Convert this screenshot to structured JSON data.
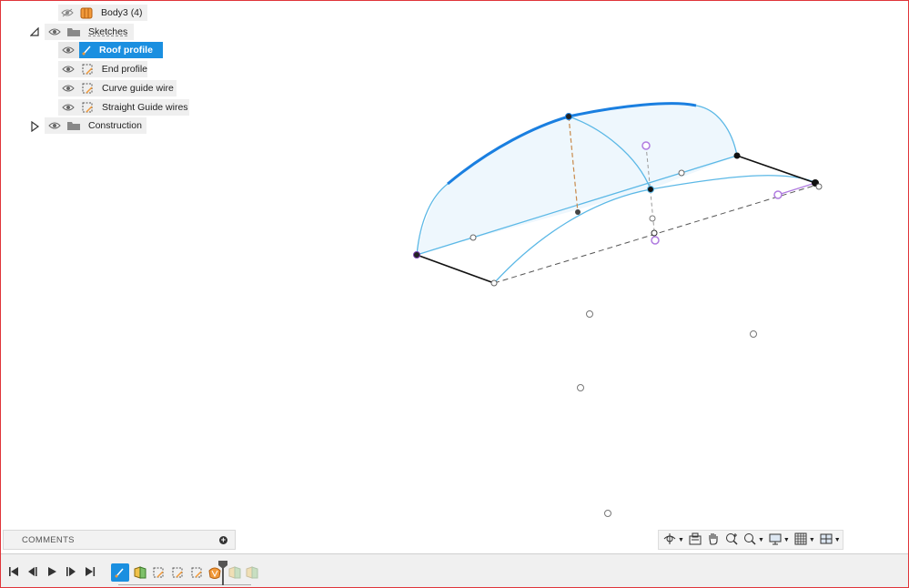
{
  "browser": {
    "items": [
      {
        "label": "Body3 (4)"
      },
      {
        "label": "Sketches"
      },
      {
        "label": "Roof profile"
      },
      {
        "label": "End profile"
      },
      {
        "label": "Curve guide wire"
      },
      {
        "label": "Straight Guide wires"
      },
      {
        "label": "Construction"
      }
    ]
  },
  "comments": {
    "label": "COMMENTS"
  },
  "navbar": {
    "icons": [
      "orbit-icon",
      "look-at-icon",
      "pan-icon",
      "zoom-window-icon",
      "zoom-icon",
      "display-settings-icon",
      "grid-icon",
      "viewports-icon"
    ]
  },
  "timeline": {
    "controls": [
      "skip-to-start",
      "step-back",
      "play",
      "step-forward",
      "skip-to-end"
    ]
  },
  "colors": {
    "accent": "#1a8fe0",
    "curve": "#5bb8e6",
    "fill": "#e9f5fc",
    "selected_curve": "#1a7fe0",
    "construction": "#b07be0",
    "border": "#e0353a"
  }
}
